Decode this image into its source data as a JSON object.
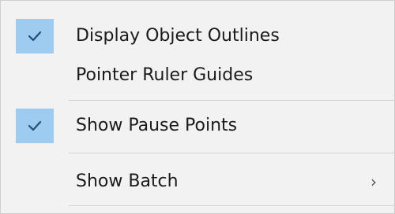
{
  "menu": {
    "items": [
      {
        "label": "Display Object Outlines",
        "checked": true
      },
      {
        "label": "Pointer Ruler Guides",
        "checked": false
      },
      {
        "label": "Show Pause Points",
        "checked": true
      },
      {
        "label": "Show Batch",
        "checked": false,
        "submenu_glyph": "›"
      }
    ],
    "check_glyph": "check-icon",
    "check_background": "#9ecbf0",
    "check_color": "#1f4f7a"
  }
}
